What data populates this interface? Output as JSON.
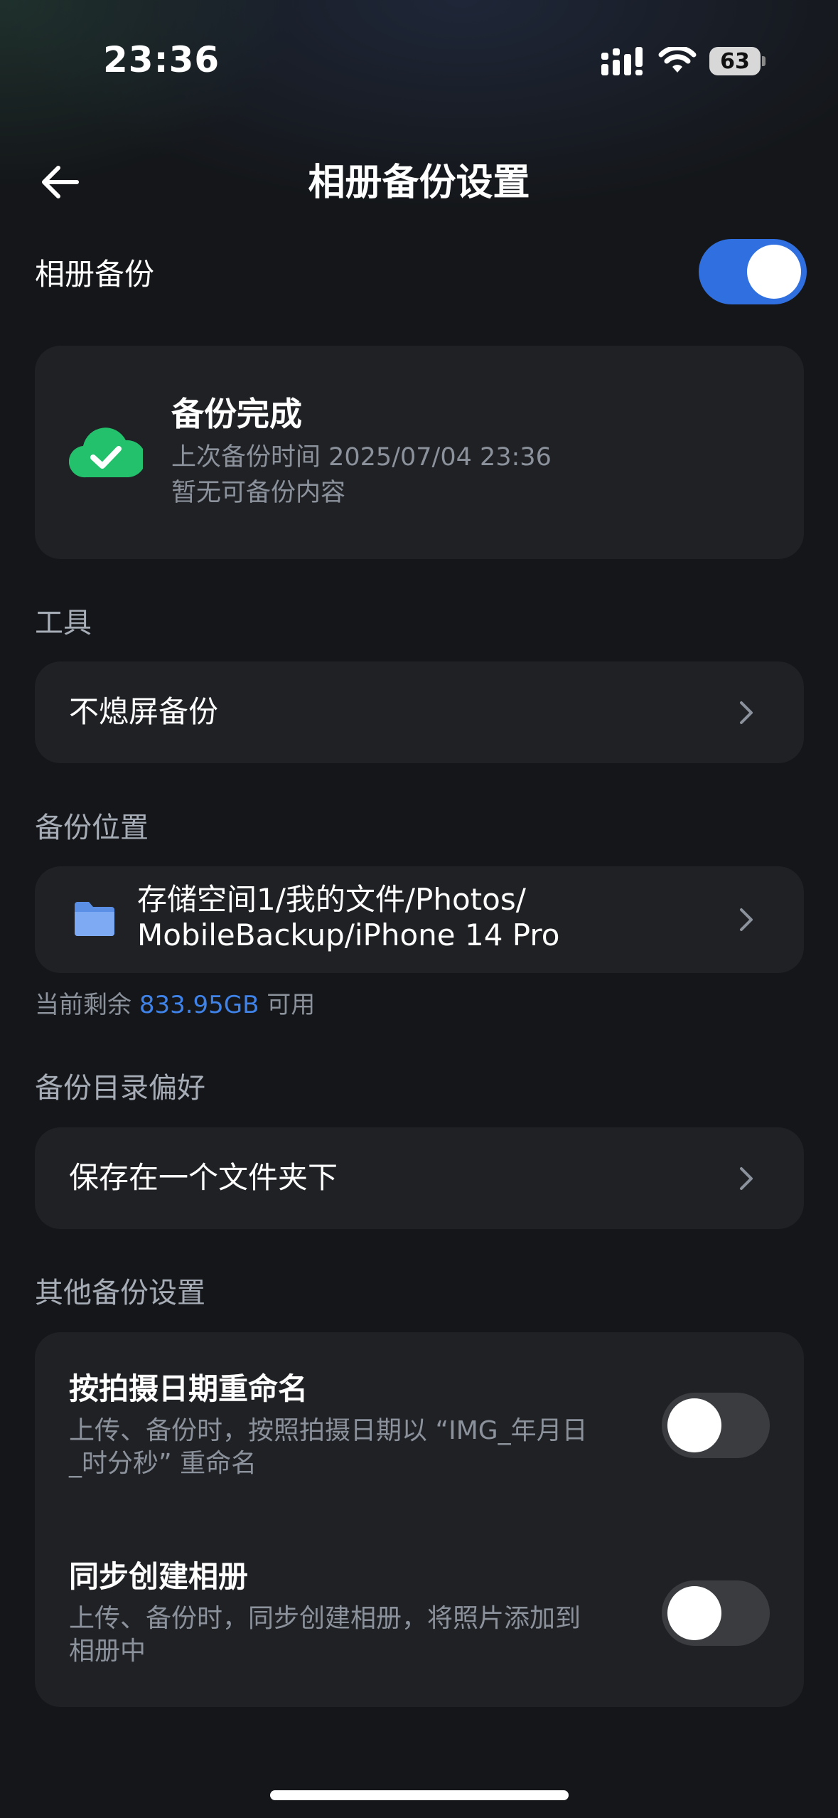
{
  "status_bar": {
    "time": "23:36",
    "battery": "63",
    "icons": [
      "signal-icon",
      "wifi-icon",
      "battery-icon"
    ]
  },
  "header": {
    "back_icon": "arrow-left-icon",
    "title": "相册备份设置"
  },
  "album_backup": {
    "label": "相册备份",
    "enabled": true
  },
  "backup_status": {
    "icon": "cloud-check-icon",
    "title": "备份完成",
    "last_backup": "上次备份时间 2025/07/04 23:36",
    "note": "暂无可备份内容"
  },
  "tools": {
    "section_label": "工具",
    "item_label": "不熄屏备份"
  },
  "location": {
    "section_label": "备份位置",
    "folder_icon": "folder-icon",
    "path_line1": "存储空间1/我的文件/Photos/",
    "path_line2": "MobileBackup/iPhone 14 Pro",
    "available_prefix": "当前剩余",
    "available_value": "833.95GB",
    "available_suffix": "可用"
  },
  "directory_pref": {
    "section_label": "备份目录偏好",
    "item_label": "保存在一个文件夹下"
  },
  "other": {
    "section_label": "其他备份设置",
    "rename": {
      "title": "按拍摄日期重命名",
      "desc_line1": "上传、备份时，按照拍摄日期以 “IMG_年月日",
      "desc_line2": "_时分秒” 重命名",
      "enabled": false
    },
    "sync_album": {
      "title": "同步创建相册",
      "desc_line1": "上传、备份时，同步创建相册，将照片添加到",
      "desc_line2": "相册中",
      "enabled": false
    }
  },
  "colors": {
    "background": "#141619",
    "card": "#1f2125",
    "accent": "#2f6fe0",
    "success": "#23c16b",
    "folder": "#6a9ef0"
  }
}
